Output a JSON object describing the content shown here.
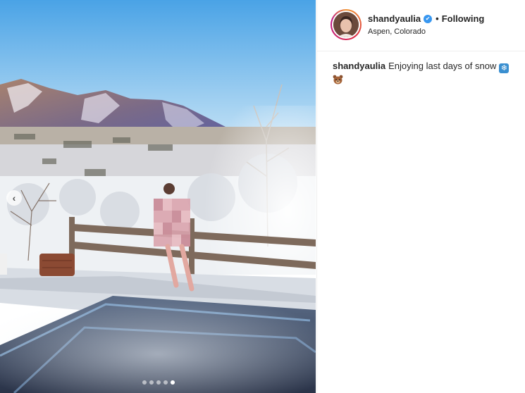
{
  "post": {
    "username": "shandyaulia",
    "verified": true,
    "separator": "•",
    "follow_status": "Following",
    "location": "Aspen, Colorado",
    "caption_text": "Enjoying last days of snow",
    "caption_emojis": [
      "snowflake-icon",
      "bear-face-icon"
    ]
  },
  "carousel": {
    "total_slides": 5,
    "active_slide": 5,
    "prev_arrow": "‹"
  },
  "colors": {
    "verified_blue": "#3897f0",
    "story_ring": "#dc2743",
    "text": "#262626"
  }
}
